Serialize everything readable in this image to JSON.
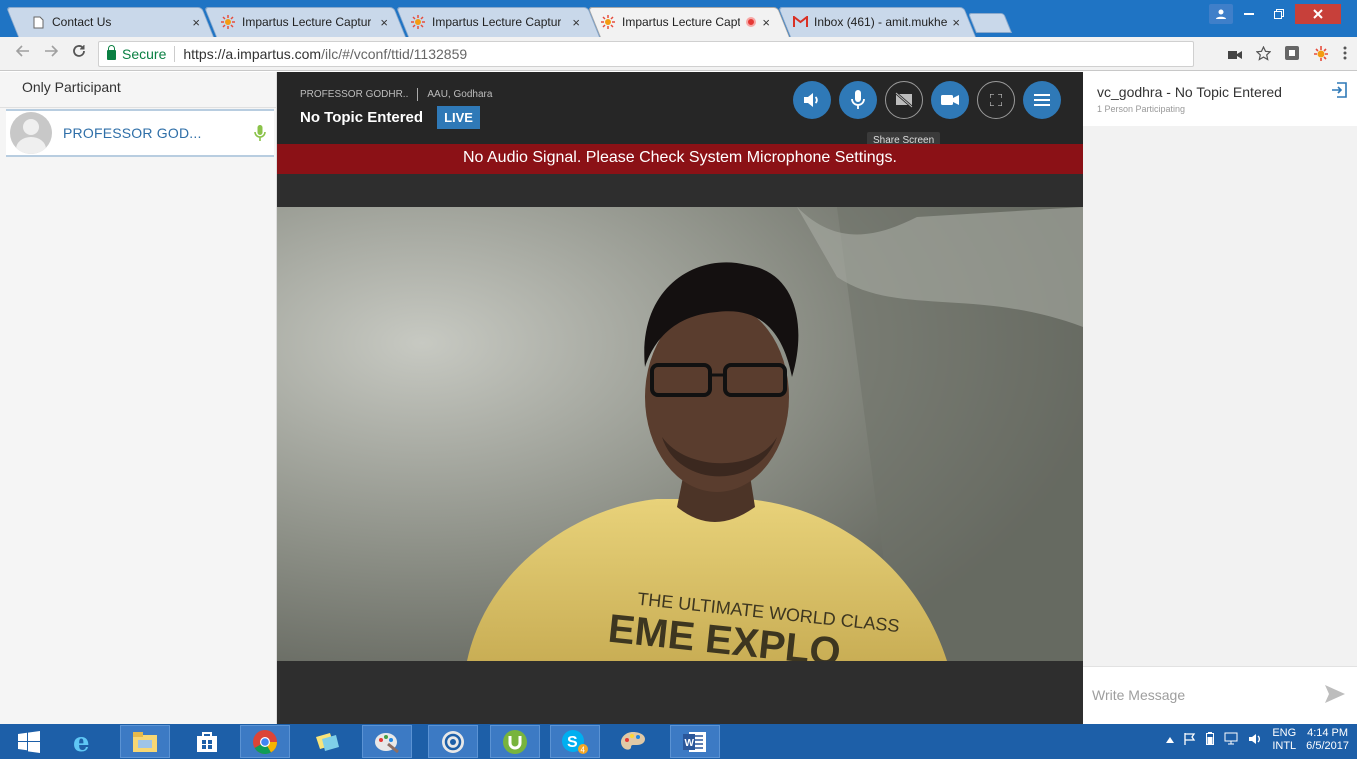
{
  "browser": {
    "tabs": [
      {
        "title": "Contact Us",
        "icon": "page-icon",
        "active": false
      },
      {
        "title": "Impartus Lecture Captur",
        "icon": "impartus-icon",
        "active": false
      },
      {
        "title": "Impartus Lecture Captur",
        "icon": "impartus-icon",
        "active": false
      },
      {
        "title": "Impartus Lecture Capt",
        "icon": "impartus-icon",
        "active": true
      },
      {
        "title": "Inbox (461) - amit.mukhe",
        "icon": "gmail-icon",
        "active": false
      }
    ],
    "close_glyph": "×",
    "secure_label": "Secure",
    "url_host": "https://a.impartus.com",
    "url_path": "/ilc/#/vconf/ttid/1132859"
  },
  "left_panel": {
    "heading": "Only Participant",
    "participants": [
      {
        "name": "PROFESSOR GOD..."
      }
    ]
  },
  "conference": {
    "host": "PROFESSOR GODHR..",
    "location": "AAU, Godhara",
    "topic": "No Topic Entered",
    "live_badge": "LIVE",
    "tooltip": "Share Screen",
    "banner": "No Audio Signal. Please Check System Microphone Settings.",
    "accent": "#2f79b7",
    "banner_color": "#8b1116"
  },
  "chat": {
    "title": "vc_godhra - No Topic Entered",
    "subtitle": "1 Person Participating",
    "input_placeholder": "Write Message"
  },
  "taskbar": {
    "lang_top": "ENG",
    "lang_bottom": "INTL",
    "time": "4:14 PM",
    "date": "6/5/2017",
    "apps": [
      "windows-start-icon",
      "internet-explorer-icon",
      "file-explorer-icon",
      "store-icon",
      "chrome-icon",
      "sticky-notes-icon",
      "paint-icon",
      "media-icon",
      "utorrent-icon",
      "skype-icon",
      "paint-palette-icon",
      "word-icon"
    ]
  }
}
